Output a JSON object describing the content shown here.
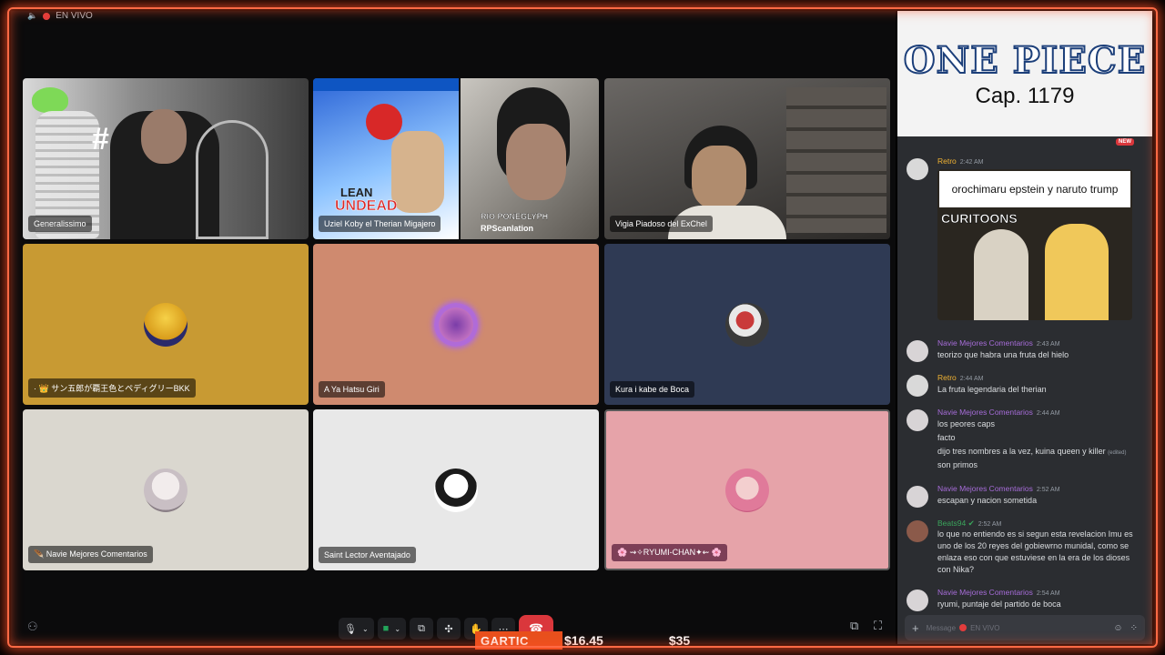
{
  "live": {
    "label": "EN VIVO"
  },
  "tiles": [
    {
      "name": "Generalissimo",
      "kind": "camera"
    },
    {
      "name": "Uziel Koby el Therian Migajero",
      "kind": "camera",
      "overlay_title": "LEAN",
      "overlay_sub": "UNDEAD",
      "side_tag": "RIO PONEGLYPH",
      "side_sub": "RPScanlation"
    },
    {
      "name": "Vigia Piadoso del ExChel",
      "kind": "camera"
    },
    {
      "name": "· 👑 サン五郎が覇王色とペディグリーBKK",
      "bg": "#c89a33"
    },
    {
      "name": "A Ya Hatsu Giri",
      "bg": "#cf8a6f"
    },
    {
      "name": "Kura i kabe de Boca",
      "bg": "#2f3a54"
    },
    {
      "name": "🪶 Navie Mejores Comentarios",
      "bg": "#dad7cf"
    },
    {
      "name": "Saint Lector Aventajado",
      "bg": "#e8e8e8"
    },
    {
      "name": "🌸 ⇝✧RYUMI-CHAN✦⇜ 🌸",
      "bg": "#e6a3a9"
    }
  ],
  "banner": {
    "logo": "ONE PIECE",
    "chapter": "Cap. 1179",
    "new_badge": "NEW"
  },
  "messages": [
    {
      "author": "Retro",
      "color": "#f0b232",
      "time": "2:42 AM",
      "meme_caption": "orochimaru epstein y naruto trump",
      "meme_brand": "CURITOONS"
    },
    {
      "author": "Navie Mejores Comentarios",
      "color": "#a66cd8",
      "time": "2:43 AM",
      "lines": [
        "teorizo que habra una fruta del hielo"
      ]
    },
    {
      "author": "Retro",
      "color": "#f0b232",
      "time": "2:44 AM",
      "lines": [
        "La fruta legendaria del therian"
      ]
    },
    {
      "author": "Navie Mejores Comentarios",
      "color": "#a66cd8",
      "time": "2:44 AM",
      "lines": [
        "los peores caps",
        "facto",
        "dijo tres nombres a la vez, kuina queen y killer",
        "son primos"
      ],
      "edited": "(edited)"
    },
    {
      "author": "Navie Mejores Comentarios",
      "color": "#a66cd8",
      "time": "2:52 AM",
      "lines": [
        "escapan y nacion sometida"
      ]
    },
    {
      "author": "Beats94",
      "color": "#3ba55c",
      "time": "2:52 AM",
      "lines": [
        "lo que no entiendo es si segun esta revelacion Imu es uno de los 20 reyes del gobiewrno munidal, como se enlaza eso con que estuviese en la era de los dioses con Nika?"
      ]
    },
    {
      "author": "Navie Mejores Comentarios",
      "color": "#a66cd8",
      "time": "2:54 AM",
      "lines": [
        "ryumi, puntaje del partido de boca"
      ]
    }
  ],
  "composer": {
    "placeholder": "Message",
    "channel": "EN VIVO"
  },
  "ticker": {
    "label": "GARTIC",
    "price1": "$16.45",
    "price2": "$35"
  },
  "colors": {
    "frame": "#ff6a45",
    "hangup": "#da373c",
    "sidebar": "#2b2d31"
  }
}
